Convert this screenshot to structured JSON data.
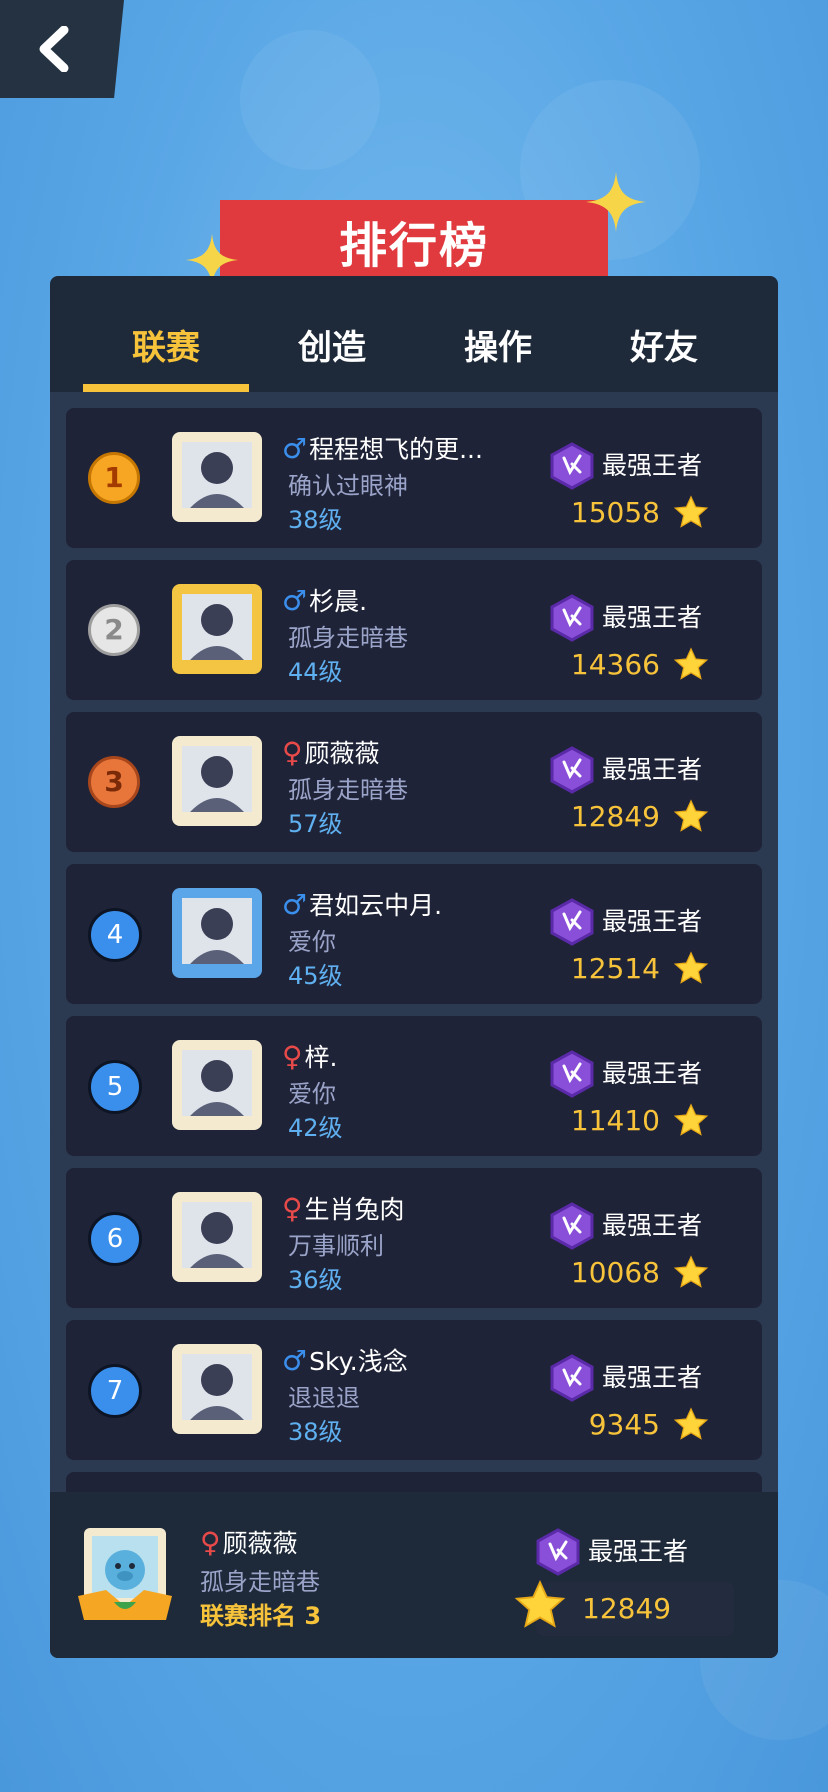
{
  "header": {
    "title": "排行榜"
  },
  "tabs": [
    {
      "label": "联赛",
      "active": true
    },
    {
      "label": "创造",
      "active": false
    },
    {
      "label": "操作",
      "active": false
    },
    {
      "label": "好友",
      "active": false
    }
  ],
  "rows": [
    {
      "rank": "1",
      "name": "程程想飞的更...",
      "gender": "male",
      "sign": "确认过眼神",
      "level": "38级",
      "tier": "最强王者",
      "score": "15058"
    },
    {
      "rank": "2",
      "name": "杉晨.",
      "gender": "male",
      "sign": "孤身走暗巷",
      "level": "44级",
      "tier": "最强王者",
      "score": "14366"
    },
    {
      "rank": "3",
      "name": "顾薇薇",
      "gender": "female",
      "sign": "孤身走暗巷",
      "level": "57级",
      "tier": "最强王者",
      "score": "12849"
    },
    {
      "rank": "4",
      "name": "君如云中月.",
      "gender": "male",
      "sign": "爱你",
      "level": "45级",
      "tier": "最强王者",
      "score": "12514"
    },
    {
      "rank": "5",
      "name": "梓.",
      "gender": "female",
      "sign": "爱你",
      "level": "42级",
      "tier": "最强王者",
      "score": "11410"
    },
    {
      "rank": "6",
      "name": "生肖兔肉",
      "gender": "female",
      "sign": "万事顺利",
      "level": "36级",
      "tier": "最强王者",
      "score": "10068"
    },
    {
      "rank": "7",
      "name": "Sky.浅念",
      "gender": "male",
      "sign": "退退退",
      "level": "38级",
      "tier": "最强王者",
      "score": "9345"
    }
  ],
  "self": {
    "name": "顾薇薇",
    "gender": "female",
    "sign": "孤身走暗巷",
    "rank_label": "联赛排名 3",
    "tier": "最强王者",
    "score": "12849"
  },
  "symbols": {
    "male": "♂",
    "female": "♀"
  },
  "colors": {
    "accent": "#f7c33a",
    "banner": "#e03a3f",
    "panel": "#1e2a3a",
    "row": "#1f2337",
    "male": "#3b8fec",
    "female": "#e84a4a"
  }
}
